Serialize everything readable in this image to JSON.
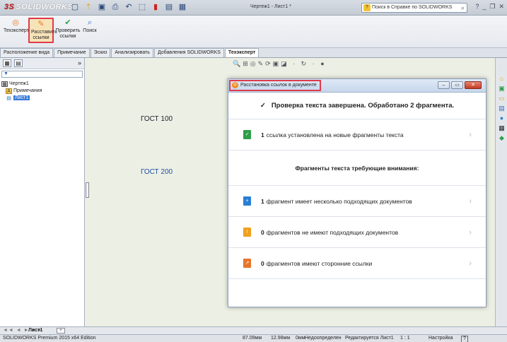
{
  "app": {
    "logo_text": "SOLIDWORKS",
    "logo_prefix": "3S",
    "document_title": "Чертеж1 - Лист1 *",
    "help_search_placeholder": "Поиск в Справке по SOLIDWORKS",
    "quick_access_icons": [
      "new-icon",
      "open-icon",
      "save-icon",
      "print-icon",
      "undo-icon",
      "select-icon",
      "rebuild-icon",
      "file-properties-icon",
      "options-icon"
    ],
    "window_controls": [
      "?",
      "_",
      "❐",
      "✕"
    ]
  },
  "ribbon": {
    "buttons": [
      {
        "label": "Техэксперт",
        "icon": "techexpert-icon"
      },
      {
        "label": "Расставить ссылки",
        "icon": "place-links-icon",
        "active": true
      },
      {
        "label": "Проверить ссылки",
        "icon": "check-links-icon"
      },
      {
        "label": "Поиск",
        "icon": "search-icon"
      }
    ]
  },
  "tabs": [
    {
      "label": "Расположение вида",
      "active": false
    },
    {
      "label": "Примечание",
      "active": false
    },
    {
      "label": "Эскиз",
      "active": false
    },
    {
      "label": "Анализировать",
      "active": false
    },
    {
      "label": "Добавления SOLIDWORKS",
      "active": false
    },
    {
      "label": "Техэксперт",
      "active": true
    }
  ],
  "feature_tree": {
    "expand_label": "»",
    "nodes": [
      {
        "label": "Чертеж1",
        "icon": "drawing-icon"
      },
      {
        "label": "Примечания",
        "icon": "annotations-icon"
      },
      {
        "label": "Лист1",
        "icon": "sheet-icon",
        "selected": true
      }
    ]
  },
  "canvas": {
    "texts": [
      {
        "label": "ГОСТ 100",
        "color": "#223344"
      },
      {
        "label": "ГОСТ 200",
        "color": "#1f4fa8"
      }
    ],
    "view_toolbar_glyphs": "🔍⊞◎✎⟳▣◪ · ↻ · ●"
  },
  "dialog": {
    "title": "Расстановка ссылок в документе",
    "header": "Проверка текста завершена. Обработано 2 фрагмента.",
    "result_row": {
      "count": "1",
      "text": "ссылка установлена на новые фрагменты текста",
      "icon": "doc-check-icon",
      "color": "#2e9e4a"
    },
    "section_title": "Фрагменты текста требующие внимания:",
    "attention_rows": [
      {
        "count": "1",
        "text": "фрагмент имеет несколько подходящих документов",
        "icon": "doc-plus-icon",
        "color": "#2a7fd4"
      },
      {
        "count": "0",
        "text": "фрагментов не имеют подходящих документов",
        "icon": "doc-warning-icon",
        "color": "#f0a020"
      },
      {
        "count": "0",
        "text": "фрагментов имеют сторонние ссылки",
        "icon": "doc-external-icon",
        "color": "#e8742a"
      }
    ]
  },
  "sheet_tabs": {
    "nav": "◄◄ ◄ ► ►►",
    "active_sheet": "Лист1"
  },
  "status_bar": {
    "edition": "SOLIDWORKS Premium 2015 x64 Edition",
    "x": "87.09мм",
    "y": "12.98мм",
    "z": "0мм",
    "state": "Недоопределен",
    "editing": "Редактируется Лист1",
    "scale": "1 : 1",
    "settings": "Настройка",
    "help": "?"
  },
  "colors": {
    "accent_red": "#e03a4a",
    "canvas_bg": "#ecefe3"
  }
}
